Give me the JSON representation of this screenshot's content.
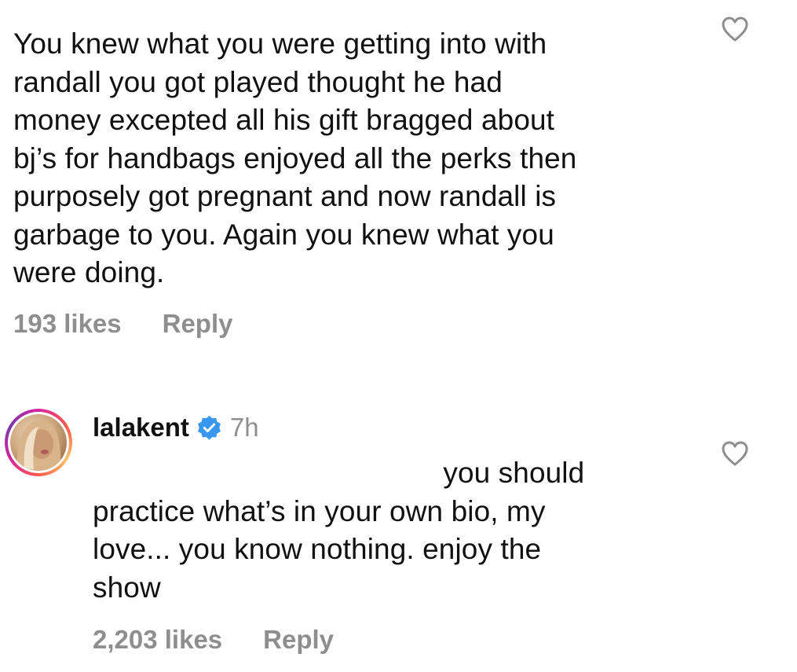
{
  "comments": [
    {
      "text": "You knew what you were getting into with\nrandall you got played thought he had\nmoney excepted all his gift bragged about\nbj’s for handbags enjoyed all the perks then\npurposely got pregnant and now randall is\ngarbage to you. Again you knew what you\nwere doing.",
      "likes": "193 likes",
      "reply_label": "Reply",
      "like_icon": "heart-outline"
    },
    {
      "username": "lalakent",
      "verified_icon": "verified-badge",
      "time": "7h",
      "text": "                                           you should\npractice what’s in your own bio, my\nlove... you know nothing. enjoy the\nshow",
      "likes": "2,203 likes",
      "reply_label": "Reply",
      "like_icon": "heart-outline"
    }
  ],
  "colors": {
    "secondary_text": "#8e8e8e",
    "verified_blue": "#3897f0"
  }
}
